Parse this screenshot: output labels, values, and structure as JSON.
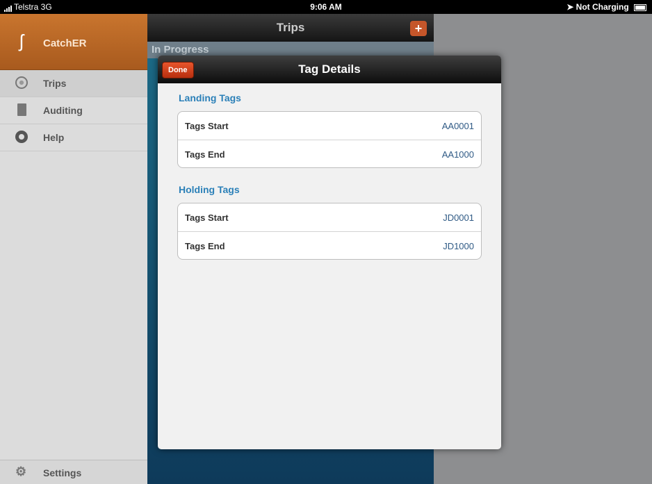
{
  "status_bar": {
    "carrier": "Telstra 3G",
    "time": "9:06 AM",
    "battery": "Not Charging"
  },
  "sidebar": {
    "app_name": "CatchER",
    "items": [
      {
        "label": "Trips",
        "icon": "radar-icon"
      },
      {
        "label": "Auditing",
        "icon": "document-icon"
      },
      {
        "label": "Help",
        "icon": "lifebuoy-icon"
      }
    ],
    "settings_label": "Settings"
  },
  "trips": {
    "title": "Trips",
    "section": "In Progress"
  },
  "modal": {
    "title": "Tag Details",
    "done_label": "Done",
    "groups": [
      {
        "title": "Landing Tags",
        "rows": [
          {
            "label": "Tags Start",
            "value": "AA0001"
          },
          {
            "label": "Tags End",
            "value": "AA1000"
          }
        ]
      },
      {
        "title": "Holding Tags",
        "rows": [
          {
            "label": "Tags Start",
            "value": "JD0001"
          },
          {
            "label": "Tags End",
            "value": "JD1000"
          }
        ]
      }
    ]
  },
  "colors": {
    "accent": "#2b80b8",
    "brand": "#c9752e",
    "done": "#d9441f"
  }
}
